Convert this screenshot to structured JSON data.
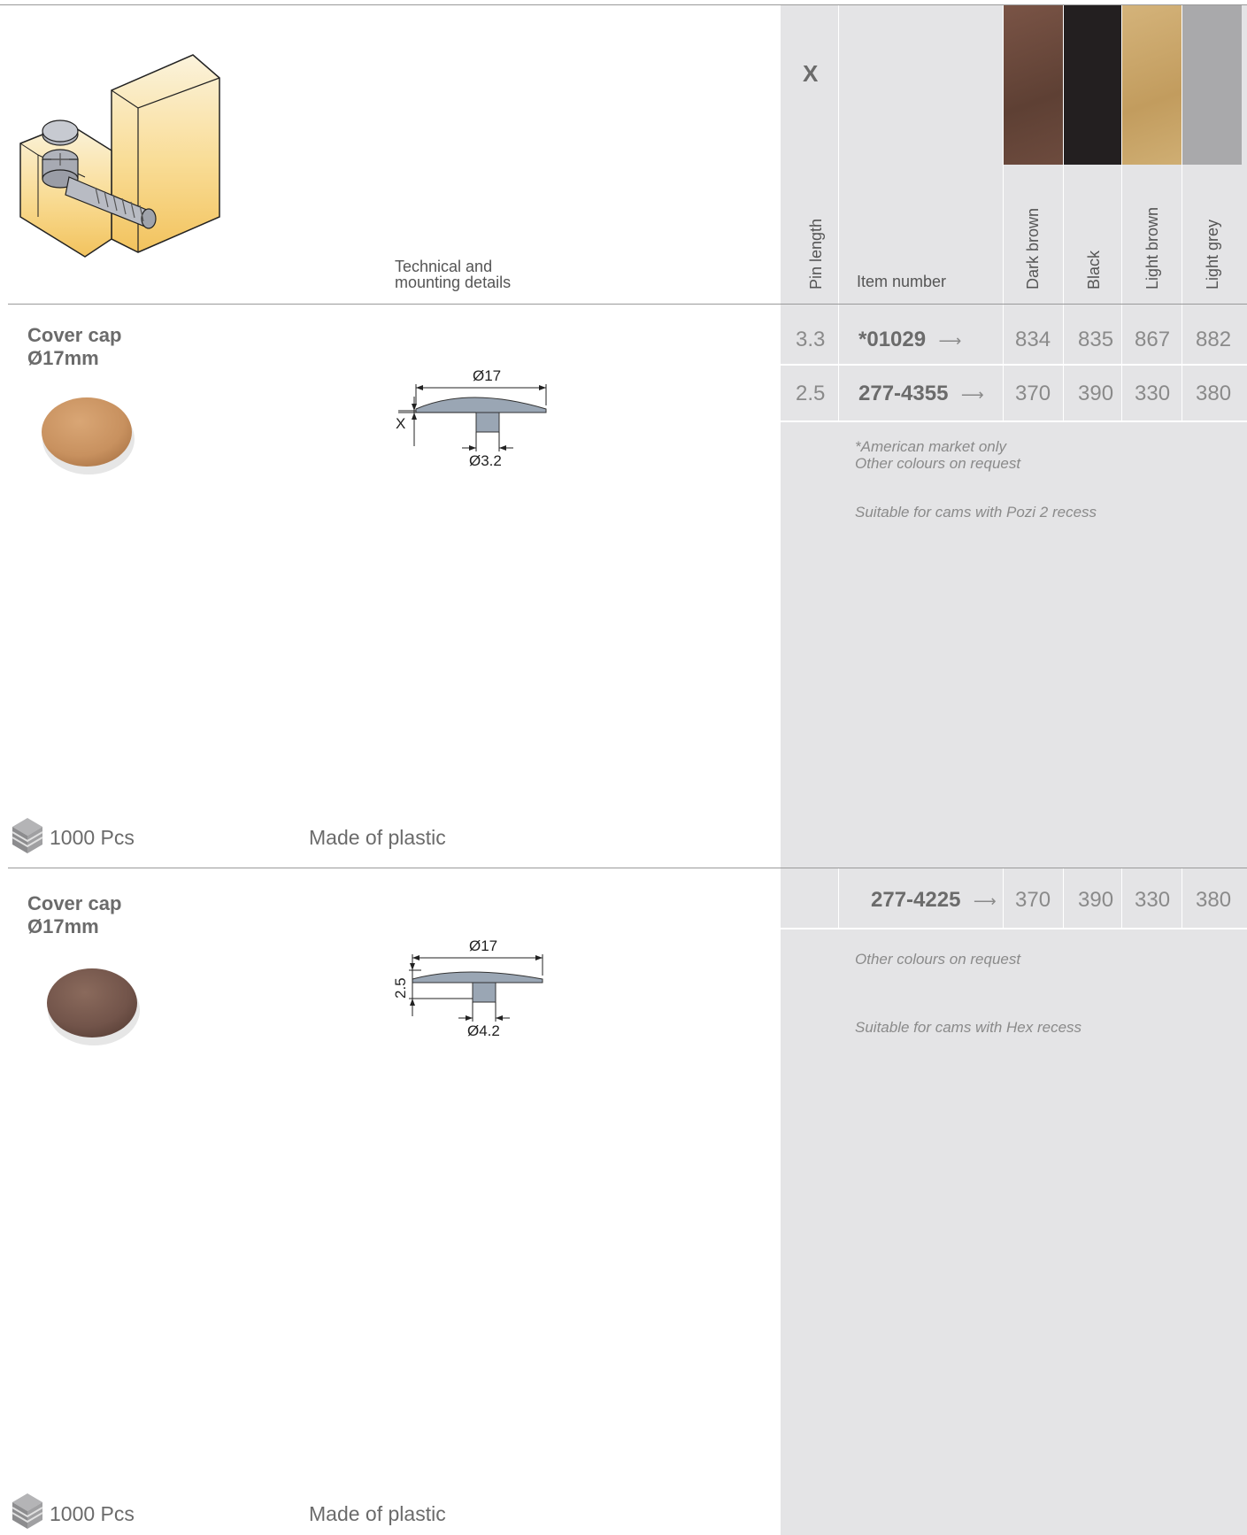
{
  "header": {
    "pin_symbol": "X",
    "tech_label_1": "Technical and",
    "tech_label_2": "mounting details",
    "pin_length_label": "Pin length",
    "item_number_label": "Item number",
    "colors": [
      {
        "name": "Dark brown",
        "hex": "#6b4a3c"
      },
      {
        "name": "Black",
        "hex": "#231f20"
      },
      {
        "name": "Light brown",
        "hex": "#c9a66b"
      },
      {
        "name": "Light grey",
        "hex": "#a9a9ab"
      }
    ]
  },
  "section1": {
    "title_line1": "Cover cap",
    "title_line2": "Ø17mm",
    "drawing": {
      "top_dim": "Ø17",
      "side_dim": "X",
      "bottom_dim": "Ø3.2"
    },
    "rows": [
      {
        "pin": "3.3",
        "item": "*01029",
        "arrow": "⟶",
        "v1": "834",
        "v2": "835",
        "v3": "867",
        "v4": "882"
      },
      {
        "pin": "2.5",
        "item": "277-4355",
        "arrow": "⟶",
        "v1": "370",
        "v2": "390",
        "v3": "330",
        "v4": "380"
      }
    ],
    "note1": "*American market only",
    "note2": "Other colours on request",
    "note3": "Suitable for cams with Pozi 2 recess",
    "pack": "1000 Pcs",
    "material": "Made of plastic"
  },
  "section2": {
    "title_line1": "Cover cap",
    "title_line2": "Ø17mm",
    "drawing": {
      "top_dim": "Ø17",
      "side_dim": "2.5",
      "bottom_dim": "Ø4.2"
    },
    "row": {
      "item": "277-4225",
      "arrow": "⟶",
      "v1": "370",
      "v2": "390",
      "v3": "330",
      "v4": "380"
    },
    "note1": "Other colours on request",
    "note2": "Suitable for cams with Hex recess",
    "pack": "1000 Pcs",
    "material": "Made of plastic"
  }
}
